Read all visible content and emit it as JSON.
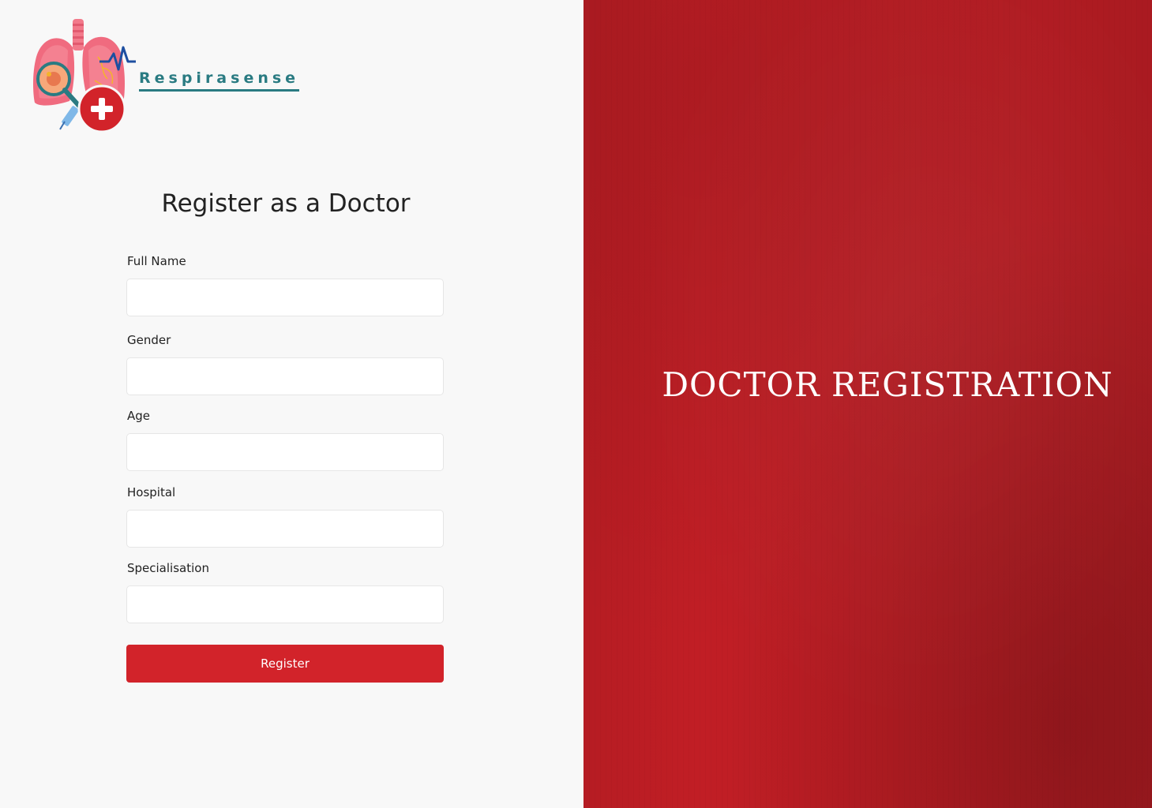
{
  "brand": {
    "name": "Respirasense"
  },
  "form": {
    "title": "Register as a Doctor",
    "fields": [
      {
        "label": "Full Name",
        "value": ""
      },
      {
        "label": "Gender",
        "value": ""
      },
      {
        "label": "Age",
        "value": ""
      },
      {
        "label": "Hospital",
        "value": ""
      },
      {
        "label": "Specialisation",
        "value": ""
      }
    ],
    "submit_label": "Register"
  },
  "hero": {
    "title": "DOCTOR REGISTRATION"
  },
  "colors": {
    "accent": "#d2232a",
    "hero_background": "#c11e25",
    "brand_teal": "#2a7b82",
    "page_background": "#f8f8f8"
  },
  "icons": [
    "lungs-logo-icon",
    "magnifier-icon",
    "heartbeat-icon",
    "plus-icon",
    "syringe-icon"
  ]
}
